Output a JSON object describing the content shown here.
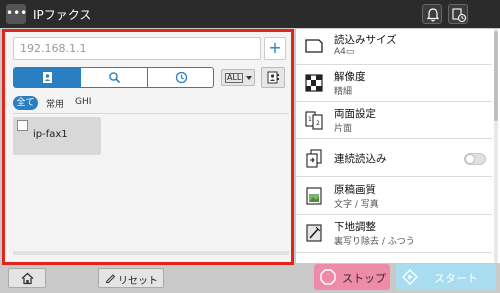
{
  "titlebar": {
    "menu_glyph": "•••",
    "title": "IPファクス",
    "icons": [
      "bell-icon",
      "job-status-icon"
    ]
  },
  "destination": {
    "address_placeholder": "192.168.1.1",
    "add_label": "+",
    "tabs": [
      "addressbook-icon",
      "search-icon",
      "history-icon"
    ],
    "active_tab": 0,
    "dropdown_label": "ALL",
    "filters": {
      "all": "全て",
      "common": "常用",
      "ghi": "GHI"
    },
    "entries": [
      {
        "name": "ip-fax1",
        "checked": false
      }
    ]
  },
  "settings": {
    "scan_size": {
      "label": "読込みサイズ",
      "value": "A4▭"
    },
    "resolution": {
      "label": "解像度",
      "value": "精細"
    },
    "duplex": {
      "label": "両面設定",
      "value": "片面"
    },
    "continuous": {
      "label": "連続読込み",
      "on": false
    },
    "quality": {
      "label": "原稿画質",
      "value": "文字 / 写真"
    },
    "background": {
      "label": "下地調整",
      "value": "裏写り除去 / ふつう"
    }
  },
  "bottom": {
    "reset_label": "リセット",
    "stop_label": "ストップ",
    "start_label": "スタート"
  },
  "colors": {
    "accent": "#2a7fc2",
    "highlight_frame": "#e1251b",
    "stop": "#ee8ba8",
    "start": "#a8ddf0",
    "titlebar": "#2b2b2b"
  }
}
